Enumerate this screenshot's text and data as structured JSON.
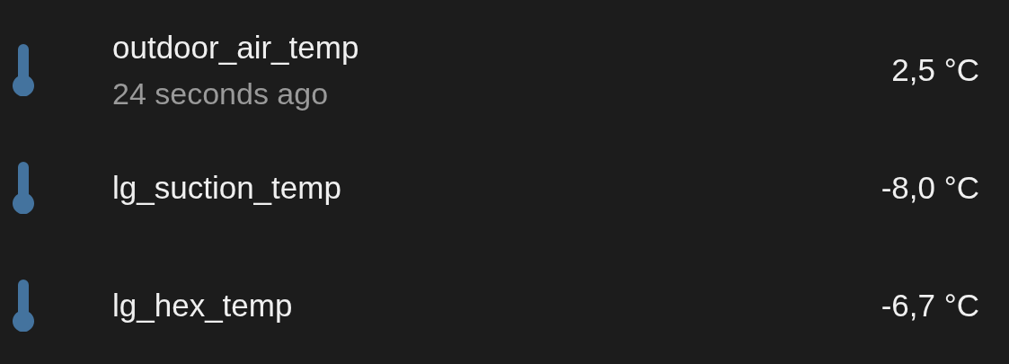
{
  "entities": [
    {
      "name": "outdoor_air_temp",
      "secondary": "24 seconds ago",
      "value": "2,5 °C"
    },
    {
      "name": "lg_suction_temp",
      "value": "-8,0 °C"
    },
    {
      "name": "lg_hex_temp",
      "value": "-6,7 °C"
    }
  ]
}
